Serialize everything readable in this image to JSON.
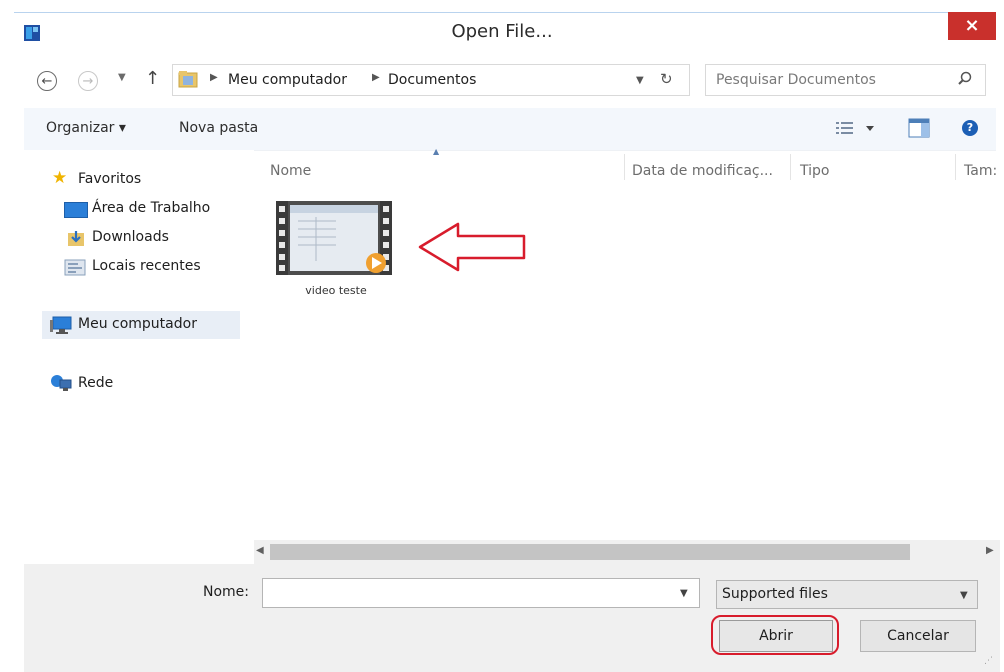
{
  "window": {
    "title": "Open File...",
    "close_glyph": "×"
  },
  "address": {
    "breadcrumb": [
      "Meu computador",
      "Documentos"
    ],
    "search_placeholder": "Pesquisar Documentos"
  },
  "toolbar": {
    "organize_label": "Organizar ▾",
    "new_folder_label": "Nova pasta"
  },
  "sidebar": {
    "items": [
      {
        "label": "Favoritos",
        "icon": "star-icon"
      },
      {
        "label": "Área de Trabalho",
        "icon": "desktop-icon"
      },
      {
        "label": "Downloads",
        "icon": "downloads-icon"
      },
      {
        "label": "Locais recentes",
        "icon": "recent-places-icon"
      },
      {
        "label": "Meu computador",
        "icon": "computer-icon"
      },
      {
        "label": "Rede",
        "icon": "network-icon"
      }
    ]
  },
  "columns": {
    "name": "Nome",
    "date": "Data de modificaç...",
    "type": "Tipo",
    "size": "Tam:"
  },
  "files": [
    {
      "name": "video teste",
      "icon": "video-file-icon"
    }
  ],
  "bottom": {
    "name_label": "Nome:",
    "name_value": "",
    "filter_value": "Supported files",
    "open_label": "Abrir",
    "cancel_label": "Cancelar"
  },
  "colors": {
    "close_red": "#c9302c",
    "annotation_red": "#d81c2c",
    "toolbar_bg": "#f3f7fc",
    "selected_nav": "#e8eef6"
  }
}
